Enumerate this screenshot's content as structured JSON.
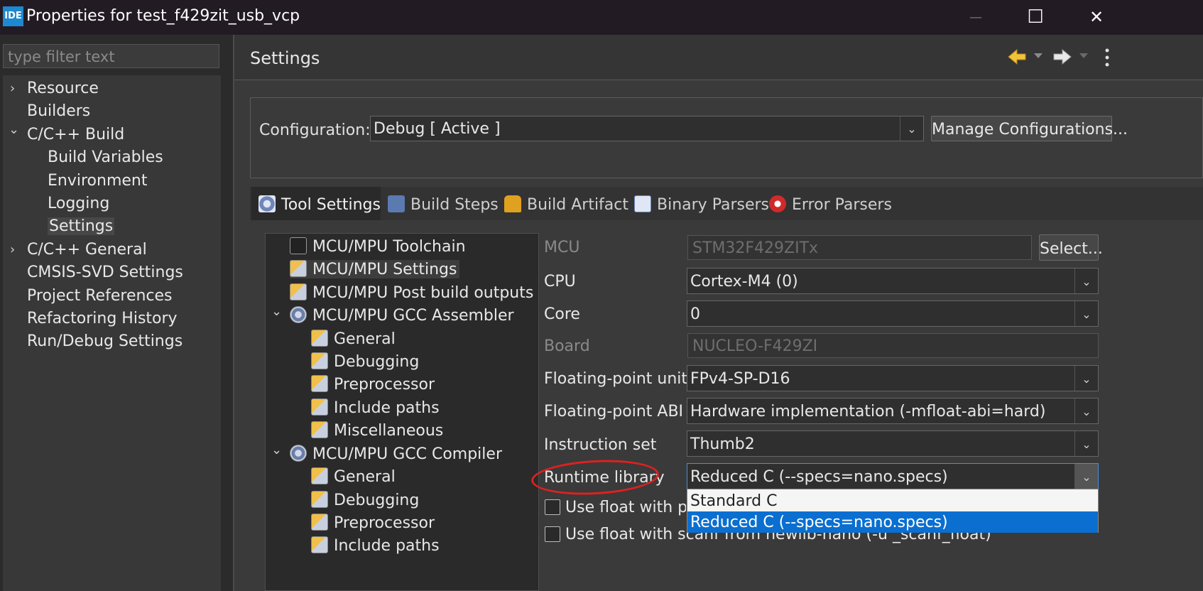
{
  "window": {
    "app_icon_text": "IDE",
    "title": "Properties for test_f429zit_usb_vcp",
    "minimize": "—",
    "maximize": "☐",
    "close": "✕"
  },
  "filter": {
    "placeholder": "type filter text"
  },
  "nav": {
    "items": [
      {
        "label": "Resource",
        "expander": "›"
      },
      {
        "label": "Builders"
      },
      {
        "label": "C/C++ Build",
        "expander": "⌄"
      },
      {
        "label": "Build Variables"
      },
      {
        "label": "Environment"
      },
      {
        "label": "Logging"
      },
      {
        "label": "Settings"
      },
      {
        "label": "C/C++ General",
        "expander": "›"
      },
      {
        "label": "CMSIS-SVD Settings"
      },
      {
        "label": "Project References"
      },
      {
        "label": "Refactoring History"
      },
      {
        "label": "Run/Debug Settings"
      }
    ]
  },
  "page": {
    "title": "Settings",
    "back_icon": "arrow-left-icon",
    "forward_icon": "arrow-right-icon"
  },
  "configuration": {
    "label": "Configuration:",
    "value": "Debug  [ Active ]",
    "manage_button": "Manage Configurations..."
  },
  "tabs": [
    {
      "label": "Tool Settings",
      "active": true
    },
    {
      "label": "Build Steps"
    },
    {
      "label": "Build Artifact"
    },
    {
      "label": "Binary Parsers"
    },
    {
      "label": "Error Parsers"
    }
  ],
  "tool_tree": [
    {
      "label": "MCU/MPU Toolchain"
    },
    {
      "label": "MCU/MPU Settings"
    },
    {
      "label": "MCU/MPU Post build outputs"
    },
    {
      "label": "MCU/MPU GCC Assembler",
      "expander": "⌄"
    },
    {
      "label": "General"
    },
    {
      "label": "Debugging"
    },
    {
      "label": "Preprocessor"
    },
    {
      "label": "Include paths"
    },
    {
      "label": "Miscellaneous"
    },
    {
      "label": "MCU/MPU GCC Compiler",
      "expander": "⌄"
    },
    {
      "label": "General"
    },
    {
      "label": "Debugging"
    },
    {
      "label": "Preprocessor"
    },
    {
      "label": "Include paths"
    }
  ],
  "form": {
    "mcu": {
      "label": "MCU",
      "value": "STM32F429ZITx",
      "select_button": "Select..."
    },
    "cpu": {
      "label": "CPU",
      "value": "Cortex-M4 (0)"
    },
    "core": {
      "label": "Core",
      "value": "0"
    },
    "board": {
      "label": "Board",
      "value": "NUCLEO-F429ZI"
    },
    "fpu": {
      "label": "Floating-point unit",
      "value": "FPv4-SP-D16"
    },
    "fpabi": {
      "label": "Floating-point ABI",
      "value": "Hardware implementation (-mfloat-abi=hard)"
    },
    "iset": {
      "label": "Instruction set",
      "value": "Thumb2"
    },
    "runtime": {
      "label": "Runtime library",
      "value": "Reduced C (--specs=nano.specs)"
    },
    "printf_float": {
      "label": "Use float with printf from newlib-nano (-u _printf_float)",
      "visible_label": "Use float with pri"
    },
    "scanf_float": {
      "label": "Use float with scanf from newlib-nano (-u _scanf_float)"
    },
    "runtime_options": [
      {
        "label": "Standard C"
      },
      {
        "label": "Reduced C (--specs=nano.specs)",
        "selected": true
      }
    ],
    "annotation_color": "#e02020"
  }
}
